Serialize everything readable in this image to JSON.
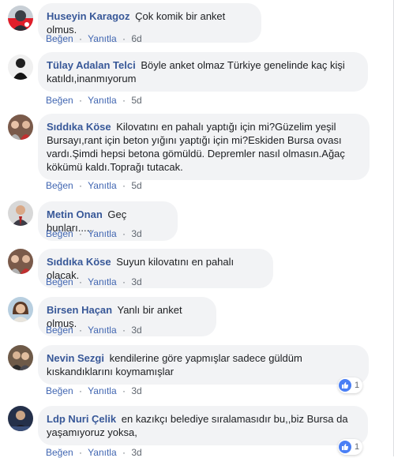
{
  "actions": {
    "like": "Beğen",
    "reply": "Yanıtla",
    "separator": "·"
  },
  "comments": [
    {
      "name": "Huseyin Karagoz",
      "text": "Çok komik bir anket olmus.",
      "time": "6d"
    },
    {
      "name": "Tülay Adalan Telci",
      "text": "Böyle anket olmaz Türkiye genelinde kaç kişi katıldı,inanmıyorum",
      "time": "5d"
    },
    {
      "name": "Sıddıka Köse",
      "text": "Kilovatını en pahalı yaptığı için mi?Güzelim yeşil Bursayı,rant için beton yığını yaptığı için mi?Eskiden Bursa ovası vardı.Şimdi hepsi betona gömüldü. Depremler nasıl olmasın.Ağaç kökümü kaldı.Toprağı tutacak.",
      "time": "5d"
    },
    {
      "name": "Metin Onan",
      "text": "Geç bunları.....",
      "time": "3d"
    },
    {
      "name": "Sıddıka Köse",
      "text": "Suyun kilovatını en pahalı olacak.",
      "time": "3d"
    },
    {
      "name": "Birsen Haçan",
      "text": "Yanlı bir anket olmuş.",
      "time": "3d"
    },
    {
      "name": "Nevin Sezgi",
      "text": "kendilerine göre yapmışlar sadece güldüm kıskandıklarını koymamışlar",
      "time": "3d",
      "likes": "1"
    },
    {
      "name": "Ldp Nuri Çelik",
      "text": "en kazıkçı belediye sıralamasıdır bu,,biz Bursa da yaşamıyoruz yoksa,",
      "time": "3d",
      "likes": "1"
    }
  ],
  "colors": {
    "name": "#385898",
    "link": "#4267b2",
    "bubble": "#f2f3f5",
    "like": "#4a7ff5"
  },
  "icons": {
    "reaction": "like-thumb-icon"
  }
}
